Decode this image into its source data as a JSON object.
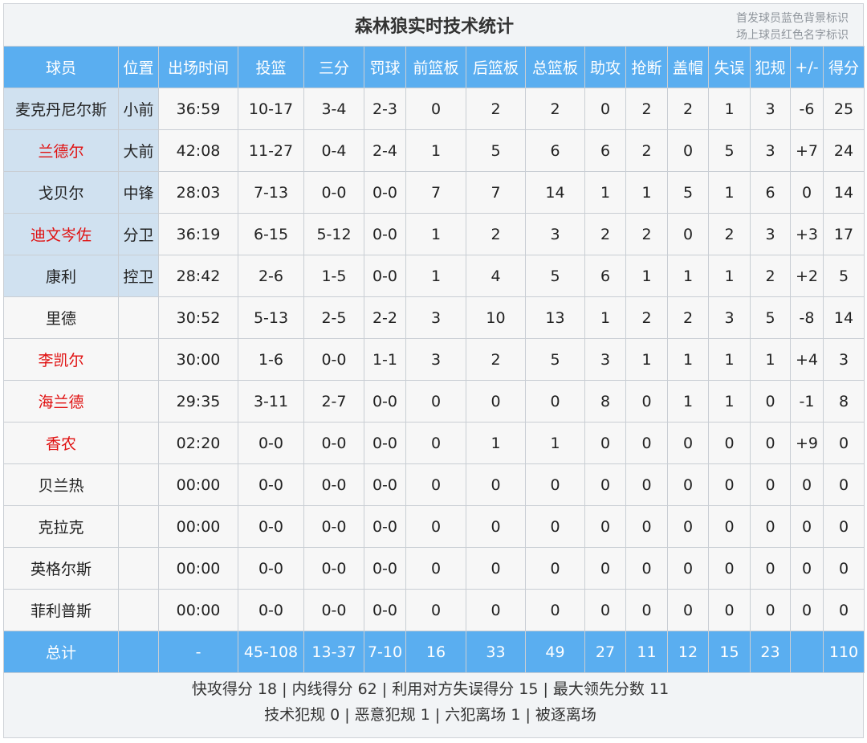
{
  "title": "森林狼实时技术统计",
  "legend": [
    "首发球员蓝色背景标识",
    "场上球员红色名字标识"
  ],
  "columns": [
    "球员",
    "位置",
    "出场时间",
    "投篮",
    "三分",
    "罚球",
    "前篮板",
    "后篮板",
    "总篮板",
    "助攻",
    "抢断",
    "盖帽",
    "失误",
    "犯规",
    "+/-",
    "得分"
  ],
  "players": [
    {
      "name": "麦克丹尼尔斯",
      "pos": "小前",
      "min": "36:59",
      "fg": "10-17",
      "tp": "3-4",
      "ft": "2-3",
      "oreb": "0",
      "dreb": "2",
      "reb": "2",
      "ast": "0",
      "stl": "2",
      "blk": "2",
      "tov": "1",
      "pf": "3",
      "pm": "-6",
      "pts": "25",
      "starter": true,
      "oncourt": false
    },
    {
      "name": "兰德尔",
      "pos": "大前",
      "min": "42:08",
      "fg": "11-27",
      "tp": "0-4",
      "ft": "2-4",
      "oreb": "1",
      "dreb": "5",
      "reb": "6",
      "ast": "6",
      "stl": "2",
      "blk": "0",
      "tov": "5",
      "pf": "3",
      "pm": "+7",
      "pts": "24",
      "starter": true,
      "oncourt": true
    },
    {
      "name": "戈贝尔",
      "pos": "中锋",
      "min": "28:03",
      "fg": "7-13",
      "tp": "0-0",
      "ft": "0-0",
      "oreb": "7",
      "dreb": "7",
      "reb": "14",
      "ast": "1",
      "stl": "1",
      "blk": "5",
      "tov": "1",
      "pf": "6",
      "pm": "0",
      "pts": "14",
      "starter": true,
      "oncourt": false
    },
    {
      "name": "迪文岑佐",
      "pos": "分卫",
      "min": "36:19",
      "fg": "6-15",
      "tp": "5-12",
      "ft": "0-0",
      "oreb": "1",
      "dreb": "2",
      "reb": "3",
      "ast": "2",
      "stl": "2",
      "blk": "0",
      "tov": "2",
      "pf": "3",
      "pm": "+3",
      "pts": "17",
      "starter": true,
      "oncourt": true
    },
    {
      "name": "康利",
      "pos": "控卫",
      "min": "28:42",
      "fg": "2-6",
      "tp": "1-5",
      "ft": "0-0",
      "oreb": "1",
      "dreb": "4",
      "reb": "5",
      "ast": "6",
      "stl": "1",
      "blk": "1",
      "tov": "1",
      "pf": "2",
      "pm": "+2",
      "pts": "5",
      "starter": true,
      "oncourt": false
    },
    {
      "name": "里德",
      "pos": "",
      "min": "30:52",
      "fg": "5-13",
      "tp": "2-5",
      "ft": "2-2",
      "oreb": "3",
      "dreb": "10",
      "reb": "13",
      "ast": "1",
      "stl": "2",
      "blk": "2",
      "tov": "3",
      "pf": "5",
      "pm": "-8",
      "pts": "14",
      "starter": false,
      "oncourt": false
    },
    {
      "name": "李凯尔",
      "pos": "",
      "min": "30:00",
      "fg": "1-6",
      "tp": "0-0",
      "ft": "1-1",
      "oreb": "3",
      "dreb": "2",
      "reb": "5",
      "ast": "3",
      "stl": "1",
      "blk": "1",
      "tov": "1",
      "pf": "1",
      "pm": "+4",
      "pts": "3",
      "starter": false,
      "oncourt": true
    },
    {
      "name": "海兰德",
      "pos": "",
      "min": "29:35",
      "fg": "3-11",
      "tp": "2-7",
      "ft": "0-0",
      "oreb": "0",
      "dreb": "0",
      "reb": "0",
      "ast": "8",
      "stl": "0",
      "blk": "1",
      "tov": "1",
      "pf": "0",
      "pm": "-1",
      "pts": "8",
      "starter": false,
      "oncourt": true
    },
    {
      "name": "香农",
      "pos": "",
      "min": "02:20",
      "fg": "0-0",
      "tp": "0-0",
      "ft": "0-0",
      "oreb": "0",
      "dreb": "1",
      "reb": "1",
      "ast": "0",
      "stl": "0",
      "blk": "0",
      "tov": "0",
      "pf": "0",
      "pm": "+9",
      "pts": "0",
      "starter": false,
      "oncourt": true
    },
    {
      "name": "贝兰热",
      "pos": "",
      "min": "00:00",
      "fg": "0-0",
      "tp": "0-0",
      "ft": "0-0",
      "oreb": "0",
      "dreb": "0",
      "reb": "0",
      "ast": "0",
      "stl": "0",
      "blk": "0",
      "tov": "0",
      "pf": "0",
      "pm": "0",
      "pts": "0",
      "starter": false,
      "oncourt": false
    },
    {
      "name": "克拉克",
      "pos": "",
      "min": "00:00",
      "fg": "0-0",
      "tp": "0-0",
      "ft": "0-0",
      "oreb": "0",
      "dreb": "0",
      "reb": "0",
      "ast": "0",
      "stl": "0",
      "blk": "0",
      "tov": "0",
      "pf": "0",
      "pm": "0",
      "pts": "0",
      "starter": false,
      "oncourt": false
    },
    {
      "name": "英格尔斯",
      "pos": "",
      "min": "00:00",
      "fg": "0-0",
      "tp": "0-0",
      "ft": "0-0",
      "oreb": "0",
      "dreb": "0",
      "reb": "0",
      "ast": "0",
      "stl": "0",
      "blk": "0",
      "tov": "0",
      "pf": "0",
      "pm": "0",
      "pts": "0",
      "starter": false,
      "oncourt": false
    },
    {
      "name": "菲利普斯",
      "pos": "",
      "min": "00:00",
      "fg": "0-0",
      "tp": "0-0",
      "ft": "0-0",
      "oreb": "0",
      "dreb": "0",
      "reb": "0",
      "ast": "0",
      "stl": "0",
      "blk": "0",
      "tov": "0",
      "pf": "0",
      "pm": "0",
      "pts": "0",
      "starter": false,
      "oncourt": false
    }
  ],
  "totals": {
    "name": "总计",
    "pos": "",
    "min": "-",
    "fg": "45-108",
    "tp": "13-37",
    "ft": "7-10",
    "oreb": "16",
    "dreb": "33",
    "reb": "49",
    "ast": "27",
    "stl": "11",
    "blk": "12",
    "tov": "15",
    "pf": "23",
    "pm": "",
    "pts": "110"
  },
  "footer": [
    "快攻得分 18 | 内线得分 62 | 利用对方失误得分 15 | 最大领先分数 11",
    "技术犯规 0 | 恶意犯规 1 | 六犯离场 1 | 被逐离场"
  ],
  "colors": {
    "header_bg": "#5aaef0",
    "starter_bg": "#d0e1f0",
    "oncourt_text": "#e01010",
    "row_bg": "#f7f7f7"
  }
}
